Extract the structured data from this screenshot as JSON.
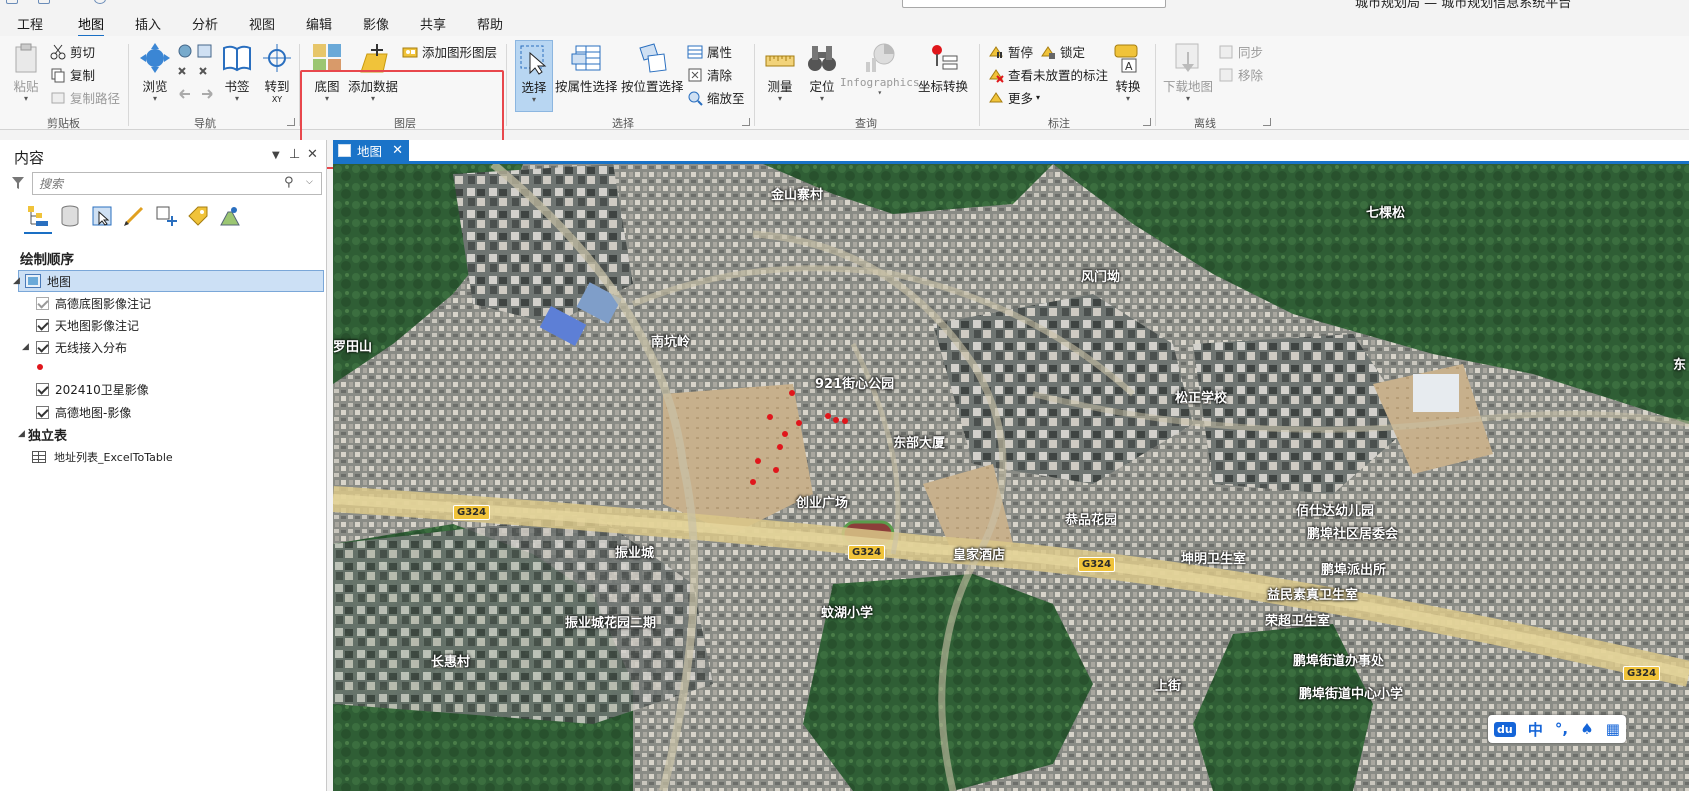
{
  "topbar": {
    "title_fragment": "城市规划局 — 城市规划信息系统平台"
  },
  "tabs": [
    "工程",
    "地图",
    "插入",
    "分析",
    "视图",
    "编辑",
    "影像",
    "共享",
    "帮助"
  ],
  "ribbon": {
    "clipboard": {
      "paste": "粘贴",
      "cut": "剪切",
      "copy": "复制",
      "copy_path": "复制路径",
      "label": "剪贴板"
    },
    "navigate": {
      "explore": "浏览",
      "bookmarks": "书签",
      "goto": "转到",
      "goto_sub": "XY",
      "label": "导航"
    },
    "layer": {
      "basemap": "底图",
      "add_data": "添加数据",
      "add_graphics": "添加图形图层",
      "label": "图层"
    },
    "selection": {
      "select": "选择",
      "by_attr": "按属性选择",
      "by_loc": "按位置选择",
      "attributes": "属性",
      "clear": "清除",
      "zoom_to": "缩放至",
      "label": "选择"
    },
    "inquiry": {
      "measure": "测量",
      "locate": "定位",
      "infographics": "Infographics",
      "convert_coord": "坐标转换",
      "label": "查询"
    },
    "labeling": {
      "pause": "暂停",
      "lock": "锁定",
      "view_unplaced": "查看未放置的标注",
      "more": "更多",
      "convert": "转换",
      "label": "标注"
    },
    "offline": {
      "download": "下载地图",
      "sync": "同步",
      "remove": "移除",
      "label": "离线"
    }
  },
  "contents": {
    "title": "内容",
    "search_placeholder": "搜索",
    "drawing_order": "绘制顺序",
    "map_item": "地图",
    "layers": [
      {
        "name": "高德底图影像注记",
        "checked": true
      },
      {
        "name": "天地图影像注记",
        "checked": true
      },
      {
        "name": "无线接入分布",
        "checked": true
      },
      {
        "name": "202410卫星影像",
        "checked": true
      },
      {
        "name": "高德地图-影像",
        "checked": true
      }
    ],
    "standalone": "独立表",
    "table": "地址列表_ExcelToTable"
  },
  "map_tab": "地图",
  "map_labels": [
    {
      "t": "金山寨村"
    },
    {
      "t": "七棵松"
    },
    {
      "t": "风门坳"
    },
    {
      "t": "罗田山"
    },
    {
      "t": "南坑岭"
    },
    {
      "t": "921街心公园"
    },
    {
      "t": "松正学校"
    },
    {
      "t": "东部大厦"
    },
    {
      "t": "创业广场"
    },
    {
      "t": "佰仕达幼儿园"
    },
    {
      "t": "鹏埠社区居委会"
    },
    {
      "t": "鹏埠派出所"
    },
    {
      "t": "恭品花园"
    },
    {
      "t": "皇家酒店"
    },
    {
      "t": "坤明卫生室"
    },
    {
      "t": "益民素真卫生室"
    },
    {
      "t": "荣超卫生室"
    },
    {
      "t": "振业城"
    },
    {
      "t": "振业城花园二期"
    },
    {
      "t": "蚊湖小学"
    },
    {
      "t": "长惠村"
    },
    {
      "t": "鹏埠街道办事处"
    },
    {
      "t": "上街"
    },
    {
      "t": "鹏埠街道中心小学"
    },
    {
      "t": "东"
    }
  ],
  "shields": [
    "G324",
    "G324",
    "G324",
    "G324"
  ],
  "ime": {
    "lang": "中",
    "punct": "°,"
  },
  "colors": {
    "accent": "#1a73c8",
    "highlight": "#e8474c",
    "point": "#e0161b",
    "highway": "#f0c33a"
  }
}
